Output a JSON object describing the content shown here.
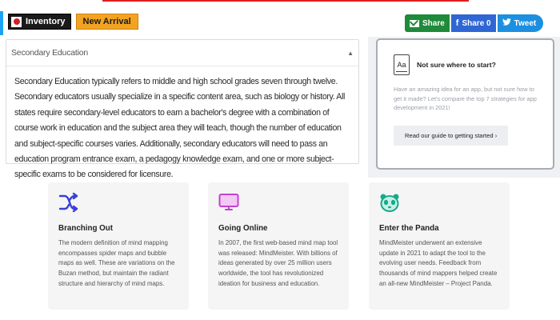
{
  "tags": {
    "inventory": "Inventory",
    "new_arrival": "New Arrival"
  },
  "share": {
    "email_label": "Share",
    "facebook_label": "Share 0",
    "twitter_label": "Tweet"
  },
  "accordion": {
    "title": "Secondary Education",
    "body": "Secondary Education typically refers to middle and high school grades seven through twelve. Secondary educators usually specialize in a specific content area, such as biology or history. All states require secondary-level educators to earn a bachelor's degree with a combination of course work in education and the subject area they will teach, though the number of education and subject-specific courses varies. Additionally, secondary educators will need to pass an education program entrance exam, a pedagogy knowledge exam, and one or more subject-specific exams to be considered for licensure."
  },
  "side_card": {
    "icon_text": "Aa",
    "title": "Not sure where to start?",
    "text": "Have an amazing idea for an app, but not sure how to get it made? Let's compare the top 7 strategies for app development in 2021!",
    "button": "Read our guide to getting started ›"
  },
  "features": [
    {
      "icon": "branching-icon",
      "color": "#3b3fd8",
      "title": "Branching Out",
      "text": "The modern definition of mind mapping encompasses spider maps and bubble maps as well. These are variations on the Buzan method, but maintain the radiant structure and hierarchy of mind maps."
    },
    {
      "icon": "monitor-icon",
      "color": "#c243cf",
      "title": "Going Online",
      "text": "In 2007, the first web-based mind map tool was released: MindMeister. With billions of ideas generated by over 25 million users worldwide, the tool has revolutionized ideation for business and education."
    },
    {
      "icon": "panda-icon",
      "color": "#17a98b",
      "title": "Enter the Panda",
      "text": "MindMeister underwent an extensive update in 2021 to adapt the tool to the evolving user needs. Feedback from thousands of mind mappers helped create an all-new MindMeister – Project Panda."
    }
  ]
}
